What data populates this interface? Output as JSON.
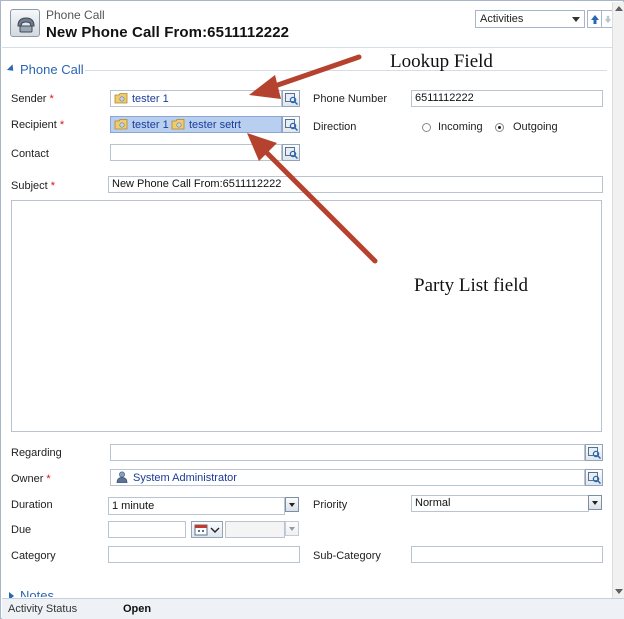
{
  "header": {
    "entity_label": "Phone Call",
    "record_title": "New Phone Call From:6511112222",
    "nav_select_value": "Activities"
  },
  "section": {
    "title": "Phone Call"
  },
  "fields": {
    "sender": {
      "label": "Sender",
      "value": "tester 1"
    },
    "phone_number": {
      "label": "Phone Number",
      "value": "6511112222"
    },
    "recipient": {
      "label": "Recipient",
      "values": [
        "tester 1",
        "tester setrt"
      ]
    },
    "direction": {
      "label": "Direction",
      "options": [
        "Incoming",
        "Outgoing"
      ],
      "selected": "Outgoing"
    },
    "contact": {
      "label": "Contact",
      "value": ""
    },
    "subject": {
      "label": "Subject",
      "value": "New Phone Call From:6511112222"
    },
    "regarding": {
      "label": "Regarding",
      "value": ""
    },
    "owner": {
      "label": "Owner",
      "value": "System Administrator"
    },
    "duration": {
      "label": "Duration",
      "value": "1 minute"
    },
    "priority": {
      "label": "Priority",
      "value": "Normal"
    },
    "due": {
      "label": "Due",
      "value": ""
    },
    "category": {
      "label": "Category",
      "value": ""
    },
    "sub_category": {
      "label": "Sub-Category",
      "value": ""
    },
    "required_marker": "*"
  },
  "annotations": {
    "lookup": "Lookup Field",
    "party_list": "Party List field"
  },
  "notes": {
    "title": "Notes"
  },
  "status_bar": {
    "label": "Activity Status",
    "value": "Open"
  },
  "colors": {
    "accent": "#2a67b1",
    "arrow": "#b5422e",
    "required": "#dd1111",
    "party_highlight": "#b8cff0"
  }
}
